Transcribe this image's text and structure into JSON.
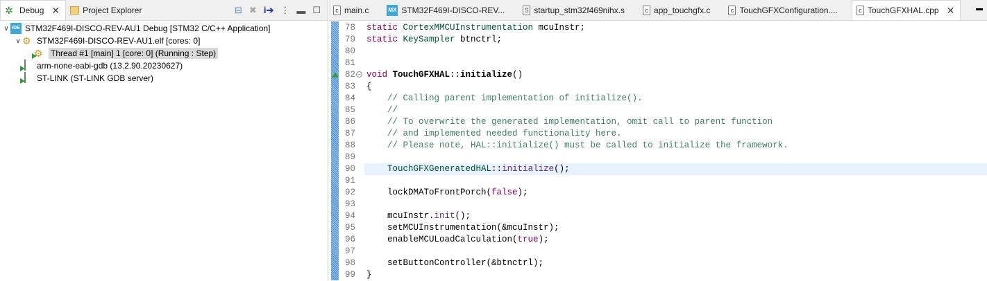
{
  "left": {
    "tabs": [
      {
        "label": "Debug",
        "icon": "bug-icon"
      },
      {
        "label": "Project Explorer",
        "icon": "project-explorer-icon"
      }
    ],
    "tree": [
      {
        "level": 0,
        "expanded": true,
        "icon": "ide-icon",
        "label": "STM32F469I-DISCO-REV-AU1 Debug [STM32 C/C++ Application]"
      },
      {
        "level": 1,
        "expanded": true,
        "icon": "process-gear-icon",
        "label": "STM32F469I-DISCO-REV-AU1.elf [cores: 0]"
      },
      {
        "level": 2,
        "icon": "thread-running-icon",
        "label": "Thread #1 [main] 1 [core: 0] (Running : Step)",
        "selected": true
      },
      {
        "level": 1,
        "icon": "gdb-server-icon",
        "label": "arm-none-eabi-gdb (13.2.90.20230627)"
      },
      {
        "level": 1,
        "icon": "gdb-server-icon",
        "label": "ST-LINK (ST-LINK GDB server)"
      }
    ]
  },
  "editor": {
    "tabs": [
      {
        "label": "main.c",
        "icon": "c-file-icon"
      },
      {
        "label": "STM32F469I-DISCO-REV...",
        "icon": "mx-file-icon"
      },
      {
        "label": "startup_stm32f469nihx.s",
        "icon": "asm-file-icon"
      },
      {
        "label": "app_touchgfx.c",
        "icon": "c-file-icon"
      },
      {
        "label": "TouchGFXConfiguration....",
        "icon": "c-file-icon"
      },
      {
        "label": "TouchGFXHAL.cpp",
        "icon": "cpp-file-icon",
        "active": true
      }
    ],
    "highlight_line": 90,
    "fold_line": 82,
    "lines": [
      {
        "n": "78",
        "t": [
          [
            "kw",
            "static "
          ],
          [
            "ty",
            "CortexMMCUInstrumentation"
          ],
          [
            "pl",
            " mcuInstr;"
          ]
        ]
      },
      {
        "n": "79",
        "t": [
          [
            "kw",
            "static "
          ],
          [
            "ty",
            "KeySampler"
          ],
          [
            "pl",
            " btnctrl;"
          ]
        ]
      },
      {
        "n": "80",
        "t": []
      },
      {
        "n": "81",
        "t": []
      },
      {
        "n": "82",
        "t": [
          [
            "kw",
            "void "
          ],
          [
            "bd",
            "TouchGFXHAL"
          ],
          [
            "pl",
            "::"
          ],
          [
            "bd",
            "initialize"
          ],
          [
            "pl",
            "()"
          ]
        ]
      },
      {
        "n": "83",
        "t": [
          [
            "pl",
            "{"
          ]
        ]
      },
      {
        "n": "84",
        "t": [
          [
            "cm",
            "    // Calling parent implementation of initialize()."
          ]
        ]
      },
      {
        "n": "85",
        "t": [
          [
            "cm",
            "    //"
          ]
        ]
      },
      {
        "n": "86",
        "t": [
          [
            "cm",
            "    // To overwrite the generated implementation, omit call to parent function"
          ]
        ]
      },
      {
        "n": "87",
        "t": [
          [
            "cm",
            "    // and implemented needed functionality here."
          ]
        ]
      },
      {
        "n": "88",
        "t": [
          [
            "cm",
            "    // Please note, HAL::initialize() must be called to initialize the framework."
          ]
        ]
      },
      {
        "n": "89",
        "t": []
      },
      {
        "n": "90",
        "t": [
          [
            "pl",
            "    "
          ],
          [
            "ty",
            "TouchGFXGeneratedHAL"
          ],
          [
            "pl",
            "::"
          ],
          [
            "fn",
            "initialize"
          ],
          [
            "pl",
            "();"
          ]
        ]
      },
      {
        "n": "91",
        "t": []
      },
      {
        "n": "92",
        "t": [
          [
            "pl",
            "    lockDMAToFrontPorch("
          ],
          [
            "kw",
            "false"
          ],
          [
            "pl",
            ");"
          ]
        ]
      },
      {
        "n": "93",
        "t": []
      },
      {
        "n": "94",
        "t": [
          [
            "pl",
            "    mcuInstr."
          ],
          [
            "fn",
            "init"
          ],
          [
            "pl",
            "();"
          ]
        ]
      },
      {
        "n": "95",
        "t": [
          [
            "pl",
            "    setMCUInstrumentation(&mcuInstr);"
          ]
        ]
      },
      {
        "n": "96",
        "t": [
          [
            "pl",
            "    enableMCULoadCalculation("
          ],
          [
            "kw",
            "true"
          ],
          [
            "pl",
            ");"
          ]
        ]
      },
      {
        "n": "97",
        "t": []
      },
      {
        "n": "98",
        "t": [
          [
            "pl",
            "    setButtonController(&btnctrl);"
          ]
        ]
      },
      {
        "n": "99",
        "t": [
          [
            "pl",
            "}"
          ]
        ]
      }
    ]
  }
}
